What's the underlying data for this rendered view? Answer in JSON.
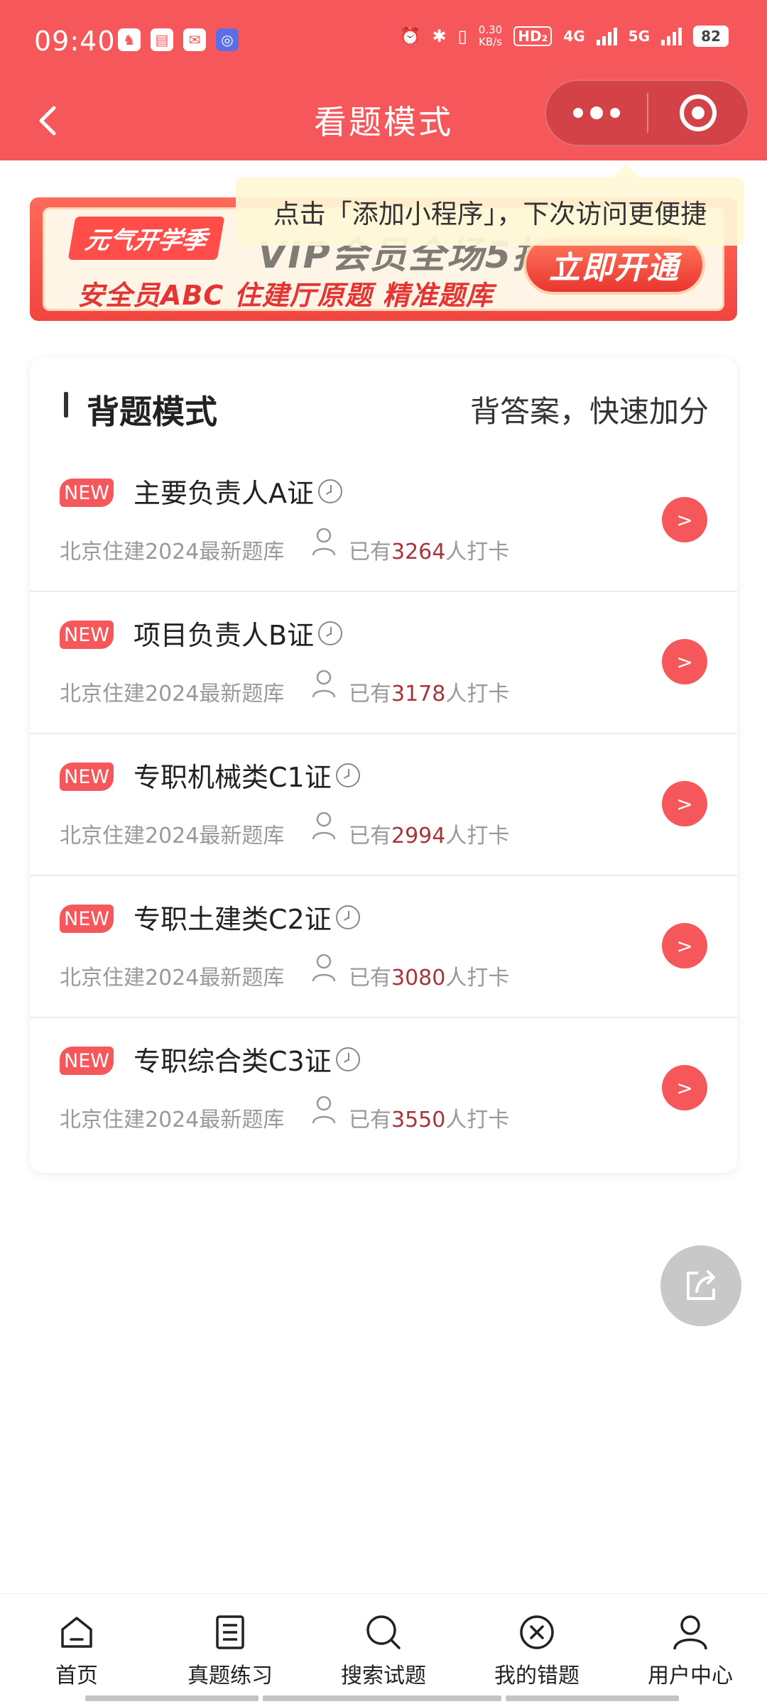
{
  "status": {
    "time": "09:40",
    "net_speed_value": "0.30",
    "net_speed_unit": "KB/s",
    "hd_label": "HD₂",
    "net1": "4G",
    "net2": "5G",
    "battery": "82"
  },
  "nav": {
    "title": "看题模式"
  },
  "tooltip": {
    "text": "点击「添加小程序」，下次访问更便捷"
  },
  "banner": {
    "tag": "元气开学季",
    "headline": "VIP会员全场5折",
    "sub": "安全员ABC  住建厅原题  精准题库",
    "cta": "立即开通"
  },
  "card": {
    "title": "背题模式",
    "slogan": "背答案，快速加分",
    "items": [
      {
        "badge": "NEW",
        "title": "主要负责人A证",
        "sub": "北京住建2024最新题库",
        "count_prefix": "已有",
        "count": "3264",
        "count_suffix": "人打卡",
        "go": ">"
      },
      {
        "badge": "NEW",
        "title": "项目负责人B证",
        "sub": "北京住建2024最新题库",
        "count_prefix": "已有",
        "count": "3178",
        "count_suffix": "人打卡",
        "go": ">"
      },
      {
        "badge": "NEW",
        "title": "专职机械类C1证",
        "sub": "北京住建2024最新题库",
        "count_prefix": "已有",
        "count": "2994",
        "count_suffix": "人打卡",
        "go": ">"
      },
      {
        "badge": "NEW",
        "title": "专职土建类C2证",
        "sub": "北京住建2024最新题库",
        "count_prefix": "已有",
        "count": "3080",
        "count_suffix": "人打卡",
        "go": ">"
      },
      {
        "badge": "NEW",
        "title": "专职综合类C3证",
        "sub": "北京住建2024最新题库",
        "count_prefix": "已有",
        "count": "3550",
        "count_suffix": "人打卡",
        "go": ">"
      }
    ]
  },
  "tabbar": {
    "items": [
      {
        "label": "首页",
        "icon": "home-icon"
      },
      {
        "label": "真题练习",
        "icon": "document-list-icon"
      },
      {
        "label": "搜索试题",
        "icon": "search-icon"
      },
      {
        "label": "我的错题",
        "icon": "wrong-circle-icon"
      },
      {
        "label": "用户中心",
        "icon": "user-icon"
      }
    ]
  },
  "colors": {
    "brand": "#f5575a",
    "count_highlight": "#a8353a"
  }
}
